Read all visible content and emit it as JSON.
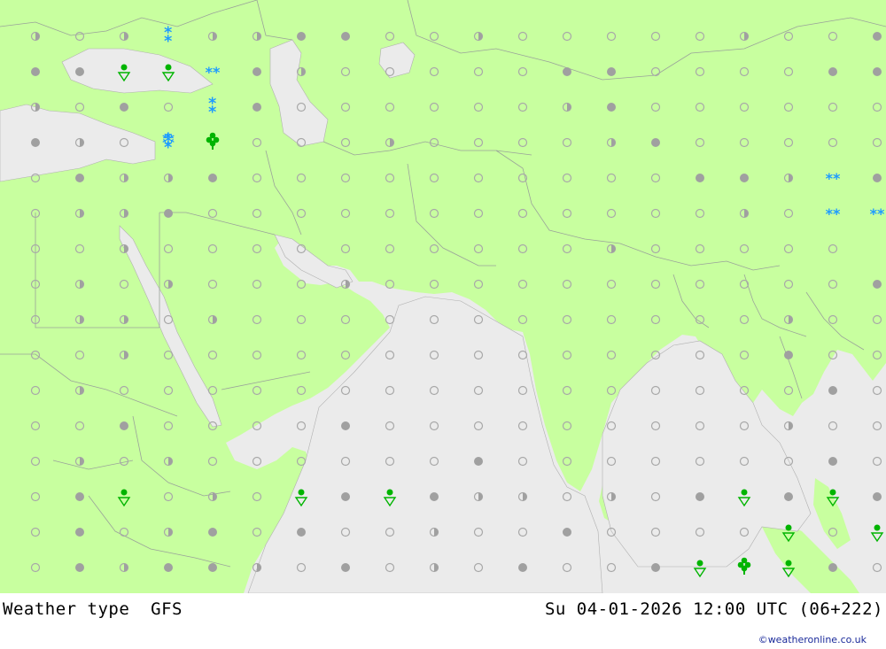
{
  "footer": {
    "title": "Weather type",
    "model": "GFS",
    "datetime": "Su 04-01-2026 12:00 UTC (06+222)",
    "credit": "©weatheronline.co.uk"
  },
  "colors": {
    "land": "#c8ff9f",
    "sea": "#ebebeb",
    "border": "#9aa39a",
    "snow": "#1e9bff",
    "rain": "#00b400",
    "dot_full": "#a0a0a0",
    "dot_ring": "#a8a8a8"
  },
  "legend_symbols": [
    "clear",
    "partly-cloudy",
    "overcast",
    "snow",
    "heavy-snow",
    "rain-shower",
    "snow-shower",
    "thunderstorm"
  ]
}
